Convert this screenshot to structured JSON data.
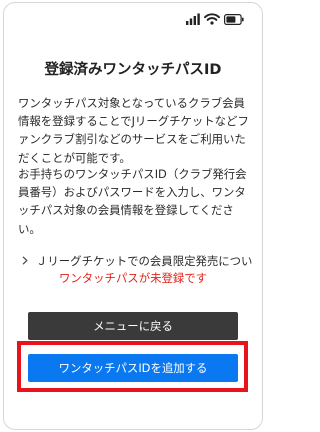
{
  "status_bar": {
    "icons": [
      "signal-icon",
      "wifi-icon",
      "battery-icon"
    ]
  },
  "page": {
    "title": "登録済みワンタッチパスID",
    "paragraph_1": "ワンタッチパス対象となっているクラブ会員情報を登録することでJリーグチケットなどファンクラブ割引などのサービスをご利用いただくことが可能です。",
    "paragraph_2": "お手持ちのワンタッチパスID（クラブ発行会員番号）およびパスワードを入力し、ワンタッチパス対象の会員情報を登録してください。",
    "link_label": "Ｊリーグチケットでの会員限定発売について",
    "error_message": "ワンタッチパスが未登録です"
  },
  "buttons": {
    "back_to_menu": "メニューに戻る",
    "add_id": "ワンタッチパスIDを追加する"
  },
  "colors": {
    "error_text": "#e2231a",
    "menu_button_bg": "#3a3a3a",
    "primary_button_bg": "#0a78f0",
    "highlight_border": "#e8131b"
  }
}
